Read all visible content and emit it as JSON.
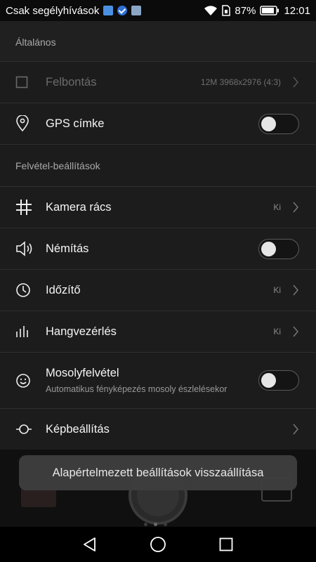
{
  "status_bar": {
    "carrier_text": "Csak segélyhívások",
    "battery_percent": "87%",
    "time": "12:01",
    "icons": [
      "mail-icon",
      "check-badge-icon",
      "image-icon",
      "wifi-icon",
      "sim-icon",
      "battery-icon"
    ]
  },
  "settings": {
    "sections": [
      {
        "header": "Általános",
        "items": [
          {
            "label": "Felbontás",
            "value": "12M 3968x2976 (4:3)",
            "icon": "checkbox-icon",
            "control": "chevron",
            "enabled": false
          },
          {
            "label": "GPS címke",
            "icon": "location-pin-icon",
            "control": "toggle",
            "toggle_on": false
          }
        ]
      },
      {
        "header": "Felvétel-beállítások",
        "items": [
          {
            "label": "Kamera rács",
            "value": "Ki",
            "icon": "grid-icon",
            "control": "chevron"
          },
          {
            "label": "Némítás",
            "icon": "speaker-icon",
            "control": "toggle",
            "toggle_on": false
          },
          {
            "label": "Időzítő",
            "value": "Ki",
            "icon": "clock-icon",
            "control": "chevron"
          },
          {
            "label": "Hangvezérlés",
            "value": "Ki",
            "icon": "sound-bars-icon",
            "control": "chevron"
          },
          {
            "label": "Mosolyfelvétel",
            "sublabel": "Automatikus fényképezés mosoly észlelésekor",
            "icon": "smile-icon",
            "control": "toggle",
            "toggle_on": false
          },
          {
            "label": "Képbeállítás",
            "icon": "image-adjust-icon",
            "control": "chevron"
          }
        ]
      }
    ]
  },
  "toast": {
    "text": "Alapértelmezett beállítások visszaállítása"
  },
  "colors": {
    "background": "#1c1c1c",
    "divider": "#2e2e2e",
    "toast": "#3e3e3e",
    "toggle_knob": "#e6e6e6"
  }
}
